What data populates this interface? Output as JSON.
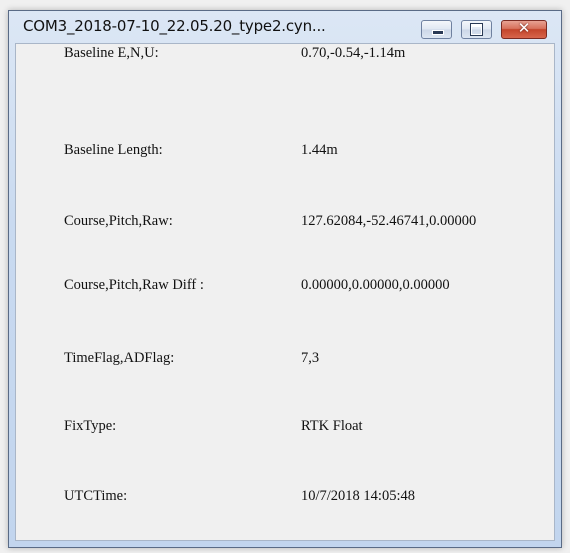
{
  "window": {
    "title": "COM3_2018-07-10_22.05.20_type2.cyn...",
    "controls": {
      "minimize_icon": "minimize-icon",
      "maximize_icon": "maximize-icon",
      "close_icon": "close-icon",
      "close_glyph": "✕"
    }
  },
  "fields": [
    {
      "label": "Baseline E,N,U:",
      "value": "0.70,-0.54,-1.14m"
    },
    {
      "label": "Baseline Length:",
      "value": "1.44m"
    },
    {
      "label": "Course,Pitch,Raw:",
      "value": "127.62084,-52.46741,0.00000"
    },
    {
      "label": "Course,Pitch,Raw Diff :",
      "value": "0.00000,0.00000,0.00000"
    },
    {
      "label": "TimeFlag,ADFlag:",
      "value": "7,3"
    },
    {
      "label": "FixType:",
      "value": "RTK Float"
    },
    {
      "label": "UTCTime:",
      "value": "10/7/2018 14:05:48"
    }
  ],
  "colors": {
    "window_frame": "#c9daf0",
    "client_bg": "#f0f0f0",
    "close_button": "#c3442b"
  }
}
